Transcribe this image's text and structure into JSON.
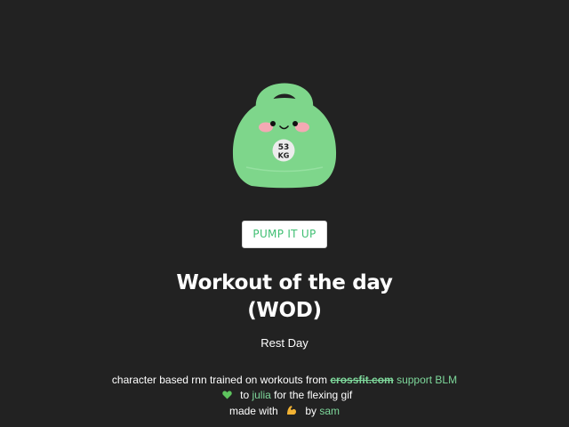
{
  "colors": {
    "background": "#222222",
    "kettlebell": "#7ed68b",
    "accent_link": "#7ed89b",
    "button_text": "#3fbf72",
    "blush": "#f4a9b4"
  },
  "kettlebell": {
    "weight_number": "53",
    "weight_unit": "KG"
  },
  "button": {
    "label": "PUMP IT UP"
  },
  "title": {
    "line1": "Workout of the day",
    "line2": "(WOD)"
  },
  "workout": {
    "text": "Rest Day"
  },
  "footer": {
    "line1_prefix": "character based rnn trained on workouts from",
    "crossfit_link": "crossfit.com",
    "blm_link": "support BLM",
    "heart_icon": "green-heart-icon",
    "line2_to": "to",
    "julia_link": "julia",
    "line2_suffix": "for the flexing gif",
    "line3_prefix": "made with",
    "flex_icon": "flexed-biceps-icon",
    "line3_by": "by",
    "sam_link": "sam"
  }
}
